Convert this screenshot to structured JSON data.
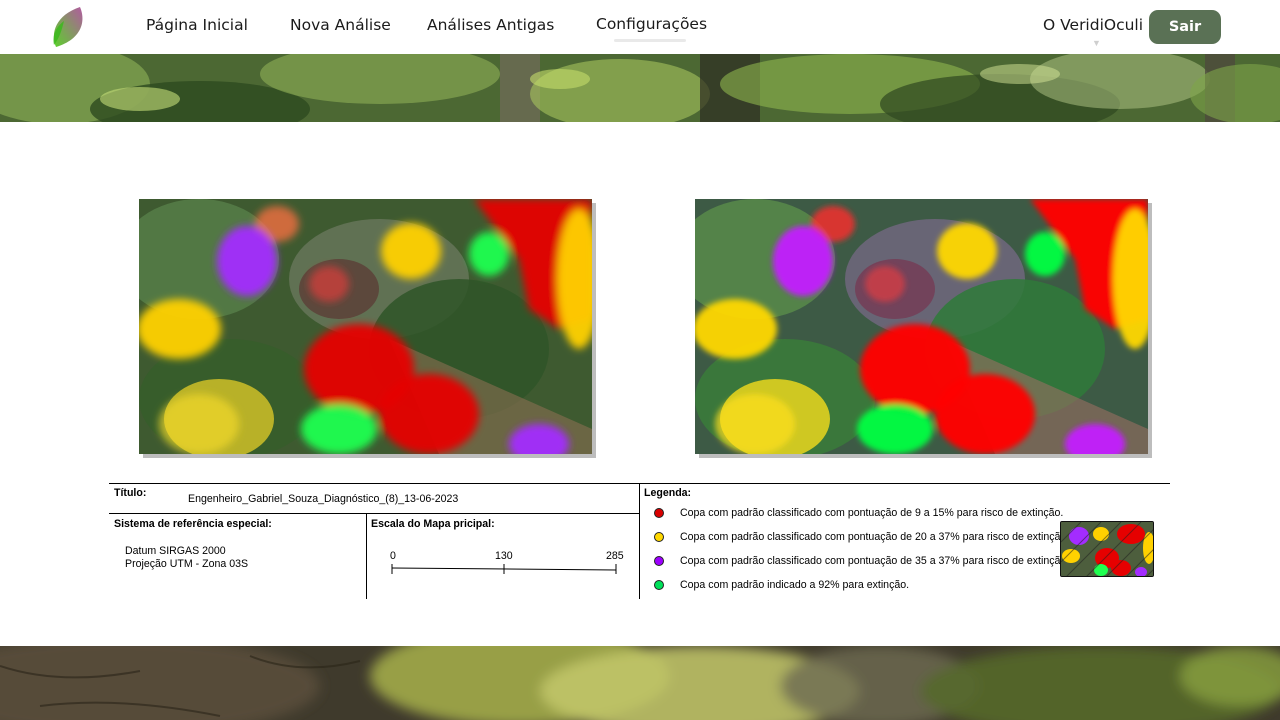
{
  "nav": {
    "home": "Página Inicial",
    "new_analysis": "Nova Análise",
    "old_analyses": "Análises Antigas",
    "settings": "Configurações",
    "about": "O VeridiOculi",
    "logout": "Sair"
  },
  "report": {
    "title_label": "Título:",
    "title_value": "Engenheiro_Gabriel_Souza_Diagnóstico_(8)_13-06-2023",
    "crs_label": "Sistema de referência especial:",
    "crs_datum": "Datum SIRGAS 2000",
    "crs_projection": "Projeção UTM - Zona 03S",
    "scale_label": "Escala do Mapa pricipal:",
    "scale_ticks": [
      "0",
      "130",
      "285"
    ],
    "legend_label": "Legenda:",
    "legend_items": [
      {
        "color": "#d90000",
        "text": "Copa com padrão  classificado com pontuação de 9 a 15% para risco de extinção."
      },
      {
        "color": "#ffd800",
        "text": "Copa com padrão classificado com pontuação de 20 a 37% para risco de extinção."
      },
      {
        "color": "#9d00ff",
        "text": "Copa com padrão classificado com pontuação de 35 a 37% para risco de extinção."
      },
      {
        "color": "#00e05a",
        "text": "Copa com padrão indicado a 92% para extinção."
      }
    ]
  },
  "colors": {
    "accent_button": "#5a7155",
    "red_class": "#d90000",
    "yellow_class": "#ffd800",
    "purple_class": "#9d00ff",
    "green_class": "#00e05a"
  }
}
